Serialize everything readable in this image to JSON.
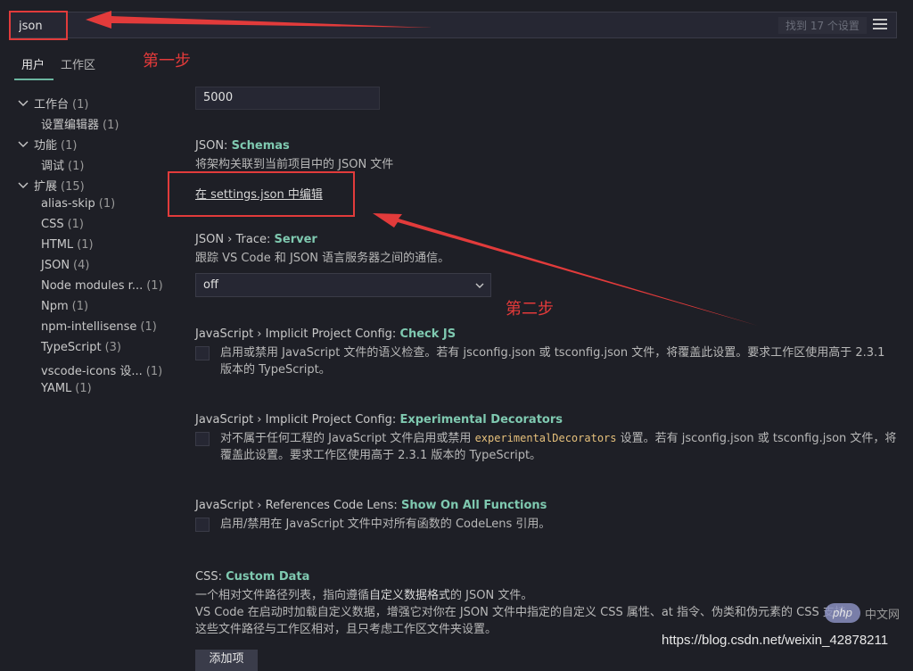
{
  "search": {
    "value": "json",
    "result_count": "找到 17 个设置",
    "filter_icon": "filter-list-icon"
  },
  "tabs": [
    {
      "label": "用户",
      "active": true
    },
    {
      "label": "工作区",
      "active": false
    }
  ],
  "tree": [
    {
      "label": "工作台",
      "count": "(1)",
      "level": 0,
      "expanded": true
    },
    {
      "label": "设置编辑器",
      "count": "(1)",
      "level": 1
    },
    {
      "label": "功能",
      "count": "(1)",
      "level": 0,
      "expanded": true
    },
    {
      "label": "调试",
      "count": "(1)",
      "level": 1
    },
    {
      "label": "扩展",
      "count": "(15)",
      "level": 0,
      "expanded": true
    },
    {
      "label": "alias-skip",
      "count": "(1)",
      "level": 1
    },
    {
      "label": "CSS",
      "count": "(1)",
      "level": 1
    },
    {
      "label": "HTML",
      "count": "(1)",
      "level": 1
    },
    {
      "label": "JSON",
      "count": "(4)",
      "level": 1
    },
    {
      "label": "Node modules r...",
      "count": "(1)",
      "level": 1
    },
    {
      "label": "Npm",
      "count": "(1)",
      "level": 1
    },
    {
      "label": "npm-intellisense",
      "count": "(1)",
      "level": 1
    },
    {
      "label": "TypeScript",
      "count": "(3)",
      "level": 1
    },
    {
      "label": "vscode-icons 设...",
      "count": "(1)",
      "level": 1
    },
    {
      "label": "YAML",
      "count": "(1)",
      "level": 1
    }
  ],
  "settings": {
    "number_value": "5000",
    "schemas": {
      "prefix": "JSON: ",
      "key": "Schemas",
      "desc": "将架构关联到当前项目中的 JSON 文件",
      "link": "在 settings.json 中编辑"
    },
    "trace": {
      "prefix": "JSON › Trace: ",
      "key": "Server",
      "desc": "跟踪 VS Code 和 JSON 语言服务器之间的通信。",
      "value": "off"
    },
    "checkjs": {
      "prefix": "JavaScript › Implicit Project Config: ",
      "key": "Check JS",
      "desc": "启用或禁用 JavaScript 文件的语义检查。若有 jsconfig.json 或 tsconfig.json 文件，将覆盖此设置。要求工作区使用高于 2.3.1 版本的 TypeScript。"
    },
    "decorators": {
      "prefix": "JavaScript › Implicit Project Config: ",
      "key": "Experimental Decorators",
      "desc_before": "对不属于任何工程的 JavaScript 文件启用或禁用 ",
      "desc_code": "experimentalDecorators",
      "desc_after": " 设置。若有 jsconfig.json 或 tsconfig.json 文件，将覆盖此设置。要求工作区使用高于 2.3.1 版本的 TypeScript。"
    },
    "codelens": {
      "prefix": "JavaScript › References Code Lens: ",
      "key": "Show On All Functions",
      "desc": "启用/禁用在 JavaScript 文件中对所有函数的 CodeLens 引用。"
    },
    "customdata": {
      "prefix": "CSS: ",
      "key": "Custom Data",
      "desc1_before": "一个相对文件路径列表，指向遵循",
      "desc1_link": "自定义数据格式",
      "desc1_after": "的 JSON 文件。",
      "desc2": "VS Code 在启动时加载自定义数据，增强它对你在 JSON 文件中指定的自定义 CSS 属性、at 指令、伪类和伪元素的 CSS 支持。",
      "desc3": "这些文件路径与工作区相对，且只考虑工作区文件夹设置。",
      "add_button": "添加项"
    }
  },
  "annotations": {
    "step1": "第一步",
    "step2": "第二步",
    "color": "#e23b3b"
  },
  "watermark": {
    "url": "https://blog.csdn.net/weixin_42878211",
    "logo": "php",
    "logo_cn": "中文网"
  },
  "colors": {
    "background": "#1e1f26",
    "accent": "#7fc9b0",
    "annotation": "#e23b3b"
  }
}
